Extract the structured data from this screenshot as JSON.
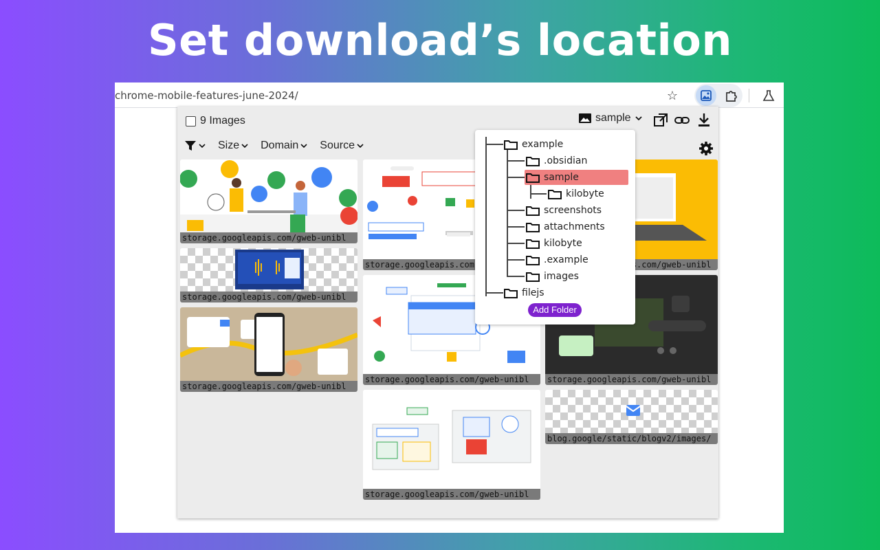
{
  "hero": {
    "title": "Set download’s location"
  },
  "browser": {
    "url": "chrome-mobile-features-june-2024/",
    "icons": [
      "star-icon",
      "image-extension-icon",
      "puzzle-extensions-icon",
      "labs-flask-icon"
    ]
  },
  "popup": {
    "count_label": "9 Images",
    "folder_label": "sample",
    "filters": [
      {
        "label": "Size"
      },
      {
        "label": "Domain"
      },
      {
        "label": "Source"
      }
    ],
    "cards": [
      {
        "url": "storage.googleapis.com/gweb-unibl"
      },
      {
        "url": "storage.googleapis.com/gweb-unibl"
      },
      {
        "url": "storage.googleapis.com/gweb-unibl"
      },
      {
        "url": "storage.googleapis.com/gweb-unibl"
      },
      {
        "url": "storage.googleapis.com/gweb-unibl"
      },
      {
        "url": "storage.googleapis.com/gweb-unibl"
      },
      {
        "url": "storage.googleapis.com/gweb-unibl"
      },
      {
        "url": "storage.googleapis.com/gweb-unibl"
      },
      {
        "url": "blog.google/static/blogv2/images/"
      }
    ]
  },
  "folder_tree": {
    "nodes": [
      {
        "label": "example",
        "selected": false
      },
      {
        "label": ".obsidian",
        "selected": false
      },
      {
        "label": "sample",
        "selected": true
      },
      {
        "label": "kilobyte",
        "selected": false
      },
      {
        "label": "screenshots",
        "selected": false
      },
      {
        "label": "attachments",
        "selected": false
      },
      {
        "label": "kilobyte",
        "selected": false
      },
      {
        "label": ".example",
        "selected": false
      },
      {
        "label": "images",
        "selected": false
      },
      {
        "label": "filejs",
        "selected": false
      }
    ],
    "add_button": "Add Folder",
    "highlight_color": "#f08080",
    "button_color": "#7e22ce"
  }
}
